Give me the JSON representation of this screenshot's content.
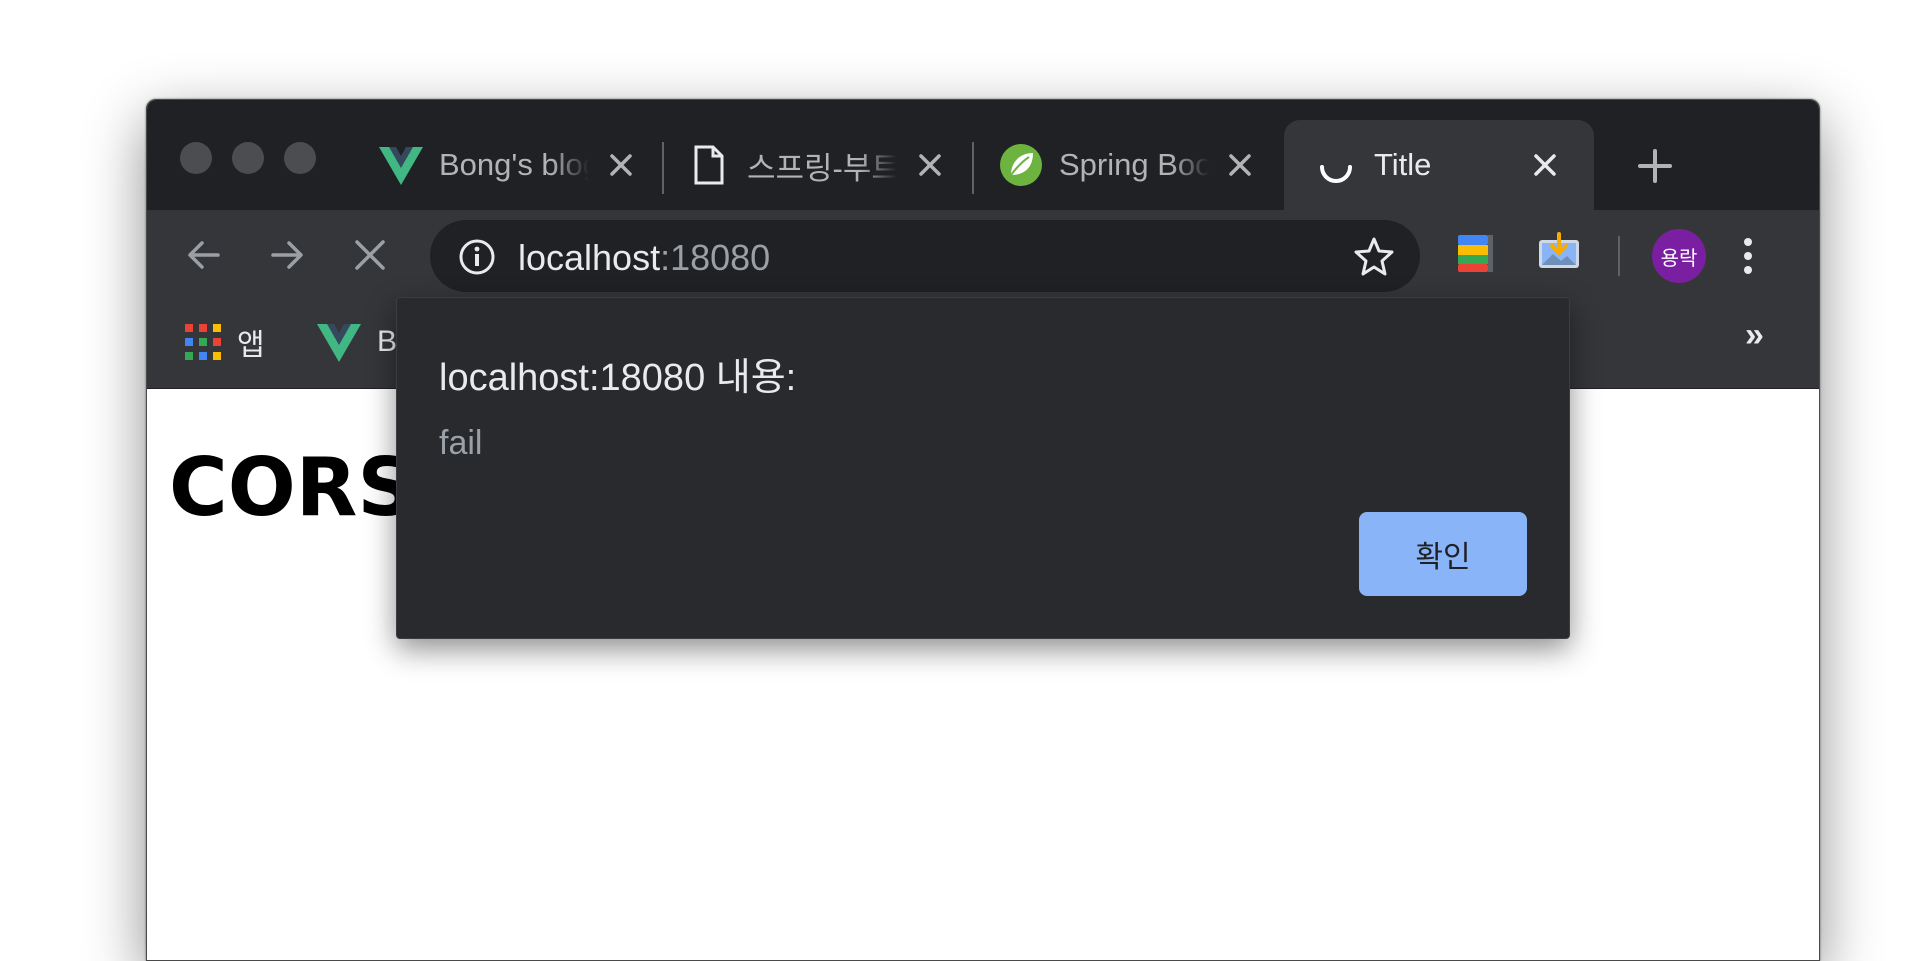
{
  "tabs": [
    {
      "label": "Bong's blog",
      "icon": "vue-logo-icon",
      "active": false
    },
    {
      "label": "스프링-부트",
      "icon": "document-icon",
      "active": false
    },
    {
      "label": "Spring Boot",
      "icon": "spring-leaf-icon",
      "active": false
    },
    {
      "label": "Title",
      "icon": "loading-spinner-icon",
      "active": true
    }
  ],
  "address_bar": {
    "host": "localhost",
    "port": ":18080"
  },
  "profile": {
    "initials": "용락",
    "color": "#7b1fa2"
  },
  "bookmarks": [
    {
      "label": "앱",
      "icon": "apps-grid-icon"
    },
    {
      "label": "B",
      "icon": "vue-logo-icon"
    }
  ],
  "bookmarks_overflow": "»",
  "page": {
    "heading": "CORS"
  },
  "dialog": {
    "title": "localhost:18080 내용:",
    "message": "fail",
    "ok_label": "확인"
  },
  "colors": {
    "accent": "#8ab4f8",
    "frame": "#202124",
    "toolbar": "#35363a",
    "vue_green": "#41b883"
  }
}
